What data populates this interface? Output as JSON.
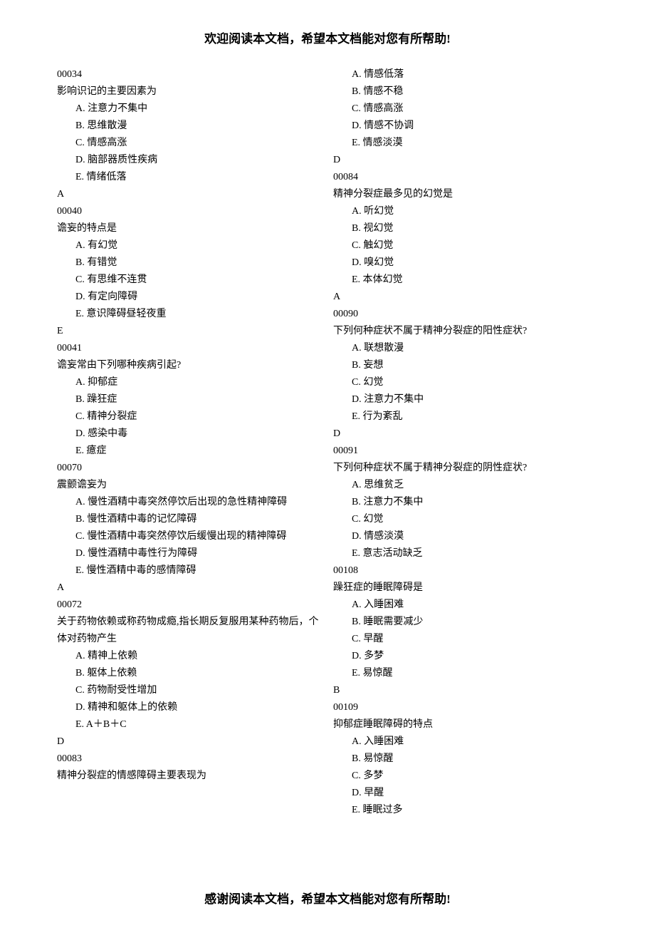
{
  "header": "欢迎阅读本文档，希望本文档能对您有所帮助!",
  "footer": "感谢阅读本文档，希望本文档能对您有所帮助!",
  "left": {
    "q1": {
      "id": "00034",
      "text": "影响识记的主要因素为",
      "a": "A.  注意力不集中",
      "b": "B.  思维散漫",
      "c": "C.  情感高涨",
      "d": "D.  脑部器质性疾病",
      "e": "E.  情绪低落",
      "ans": "A"
    },
    "q2": {
      "id": "00040",
      "text": "谵妄的特点是",
      "a": "A.  有幻觉",
      "b": "B.  有错觉",
      "c": "C.  有思维不连贯",
      "d": "D.  有定向障碍",
      "e": "E.  意识障碍昼轻夜重",
      "ans": "E"
    },
    "q3": {
      "id": "00041",
      "text": "谵妄常由下列哪种疾病引起?",
      "a": "A.  抑郁症",
      "b": "B.  躁狂症",
      "c": "C.  精神分裂症",
      "d": "D.  感染中毒",
      "e": "E.  癔症"
    },
    "q4": {
      "id": "00070",
      "text": "震颤谵妄为",
      "a": "A.  慢性酒精中毒突然停饮后出现的急性精神障碍",
      "b": "B.  慢性酒精中毒的记忆障碍",
      "c": "C.  慢性酒精中毒突然停饮后缓慢出现的精神障碍",
      "d": "D.  慢性酒精中毒性行为障碍",
      "e": "E.  慢性酒精中毒的感情障碍",
      "ans": "A"
    },
    "q5": {
      "id": "00072",
      "text": "关于药物依赖或称药物成瘾,指长期反复服用某种药物后，个体对药物产生",
      "a": "A.  精神上依赖",
      "b": "B.  躯体上依赖",
      "c": "C.  药物耐受性增加",
      "d": "D.  精神和躯体上的依赖",
      "e": "E.  A＋B＋C",
      "ans": "D"
    },
    "q6": {
      "id": "00083",
      "text": "精神分裂症的情感障碍主要表现为"
    }
  },
  "right": {
    "q6r": {
      "a": "A.  情感低落",
      "b": "B.  情感不稳",
      "c": "C.  情感高涨",
      "d": "D.  情感不协调",
      "e": "E.  情感淡漠",
      "ans": "D"
    },
    "q7": {
      "id": "00084",
      "text": "精神分裂症最多见的幻觉是",
      "a": "A.  听幻觉",
      "b": "B.  视幻觉",
      "c": "C.  触幻觉",
      "d": "D.  嗅幻觉",
      "e": "E.  本体幻觉",
      "ans": "A"
    },
    "q8": {
      "id": "00090",
      "text": "下列何种症状不属于精神分裂症的阳性症状?",
      "a": "A.  联想散漫",
      "b": "B.  妄想",
      "c": "C.  幻觉",
      "d": "D.  注意力不集中",
      "e": "E.  行为紊乱",
      "ans": "D"
    },
    "q9": {
      "id": "00091",
      "text": "下列何种症状不属于精神分裂症的阴性症状?",
      "a": "A.  思维贫乏",
      "b": "B.  注意力不集中",
      "c": "C.  幻觉",
      "d": "D.  情感淡漠",
      "e": "E.  意志活动缺乏"
    },
    "q10": {
      "id": "00108",
      "text": "躁狂症的睡眠障碍是",
      "a": "A.  入睡困难",
      "b": "B.  睡眠需要减少",
      "c": "C.  早醒",
      "d": "D.  多梦",
      "e": "E.  易惊醒",
      "ans": "B"
    },
    "q11": {
      "id": "00109",
      "text": "抑郁症睡眠障碍的特点",
      "a": "A.  入睡困难",
      "b": "B.  易惊醒",
      "c": "C.  多梦",
      "d": "D.  早醒",
      "e": "E.  睡眠过多"
    }
  }
}
